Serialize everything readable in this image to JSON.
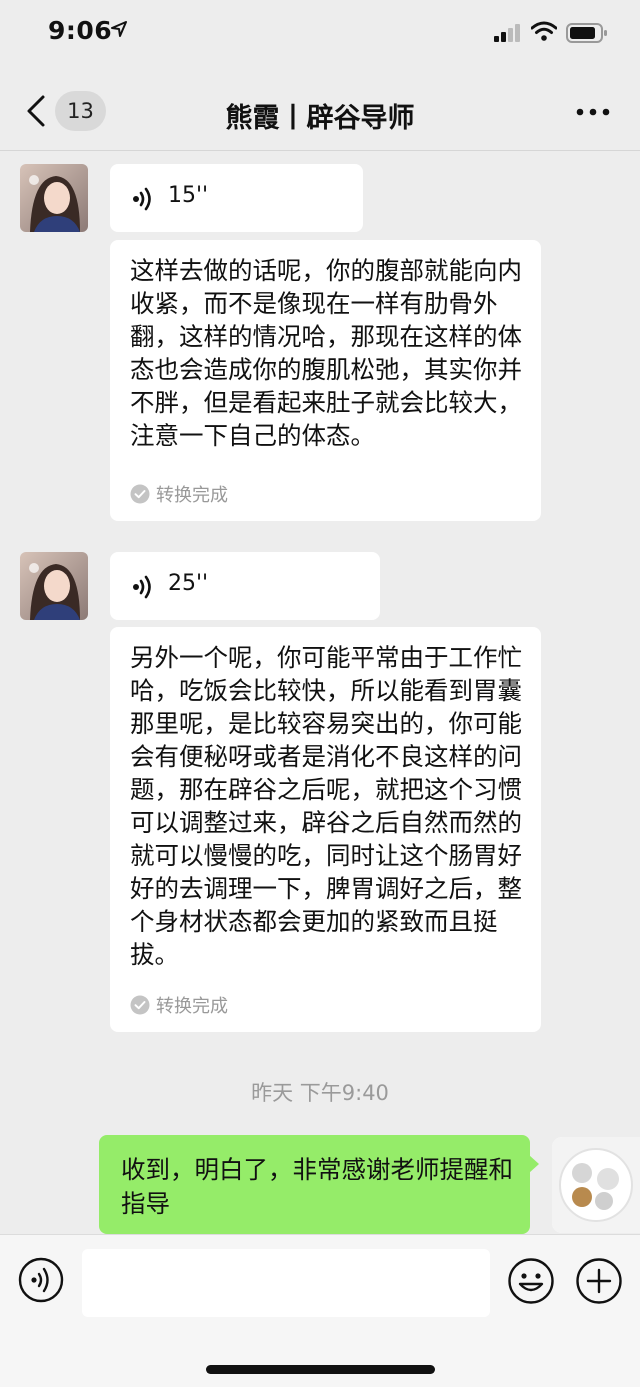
{
  "status_bar": {
    "time": "9:06"
  },
  "nav": {
    "unread_count": "13",
    "title": "熊霞丨辟谷导师"
  },
  "messages": [
    {
      "voice_duration": "15''",
      "transcript": "这样去做的话呢，你的腹部就能向内收紧，而不是像现在一样有肋骨外翻，这样的情况哈，那现在这样的体态也会造成你的腹肌松弛，其实你并不胖，但是看起来肚子就会比较大，注意一下自己的体态。",
      "status": "转换完成"
    },
    {
      "voice_duration": "25''",
      "transcript": "另外一个呢，你可能平常由于工作忙哈，吃饭会比较快，所以能看到胃囊那里呢，是比较容易突出的，你可能会有便秘呀或者是消化不良这样的问题，那在辟谷之后呢，就把这个习惯可以调整过来，辟谷之后自然而然的就可以慢慢的吃，同时让这个肠胃好好的去调理一下，脾胃调好之后，整个身材状态都会更加的紧致而且挺拔。",
      "status": "转换完成"
    }
  ],
  "timestamp": "昨天 下午9:40",
  "outgoing": {
    "text": "收到，明白了，非常感谢老师提醒和指导"
  },
  "colors": {
    "background": "#ededed",
    "outgoing_bubble": "#95ec69",
    "incoming_bubble": "#ffffff"
  }
}
